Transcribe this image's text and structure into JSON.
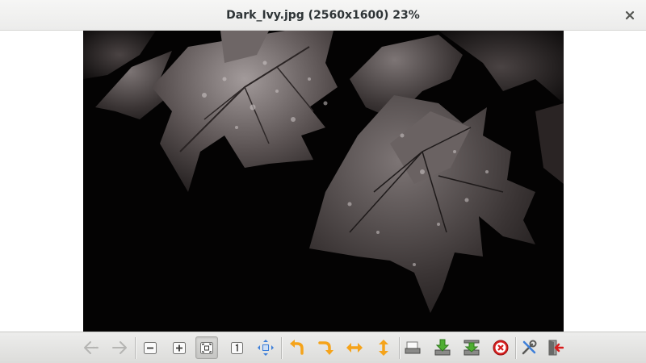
{
  "window": {
    "title": "Dark_Ivy.jpg (2560x1600) 23%"
  },
  "toolbar": {
    "buttons": [
      {
        "icon": "arrow-left-icon",
        "enabled": false
      },
      {
        "icon": "arrow-right-icon",
        "enabled": false
      },
      {
        "icon": "zoom-out-icon",
        "enabled": true
      },
      {
        "icon": "zoom-in-icon",
        "enabled": true
      },
      {
        "icon": "zoom-fit-icon",
        "enabled": true,
        "active": true
      },
      {
        "icon": "zoom-original-icon",
        "enabled": true
      },
      {
        "icon": "fullscreen-icon",
        "enabled": true
      },
      {
        "icon": "rotate-left-icon",
        "enabled": true
      },
      {
        "icon": "rotate-right-icon",
        "enabled": true
      },
      {
        "icon": "flip-horizontal-icon",
        "enabled": true
      },
      {
        "icon": "flip-vertical-icon",
        "enabled": true
      },
      {
        "icon": "open-file-icon",
        "enabled": true
      },
      {
        "icon": "save-file-icon",
        "enabled": true
      },
      {
        "icon": "save-as-icon",
        "enabled": true
      },
      {
        "icon": "delete-icon",
        "enabled": true
      },
      {
        "icon": "preferences-icon",
        "enabled": true
      },
      {
        "icon": "quit-icon",
        "enabled": true
      }
    ]
  },
  "colors": {
    "orange": "#f5a31a",
    "blue": "#3d7fd9",
    "green": "#4fae32",
    "red": "#d81e1e"
  }
}
